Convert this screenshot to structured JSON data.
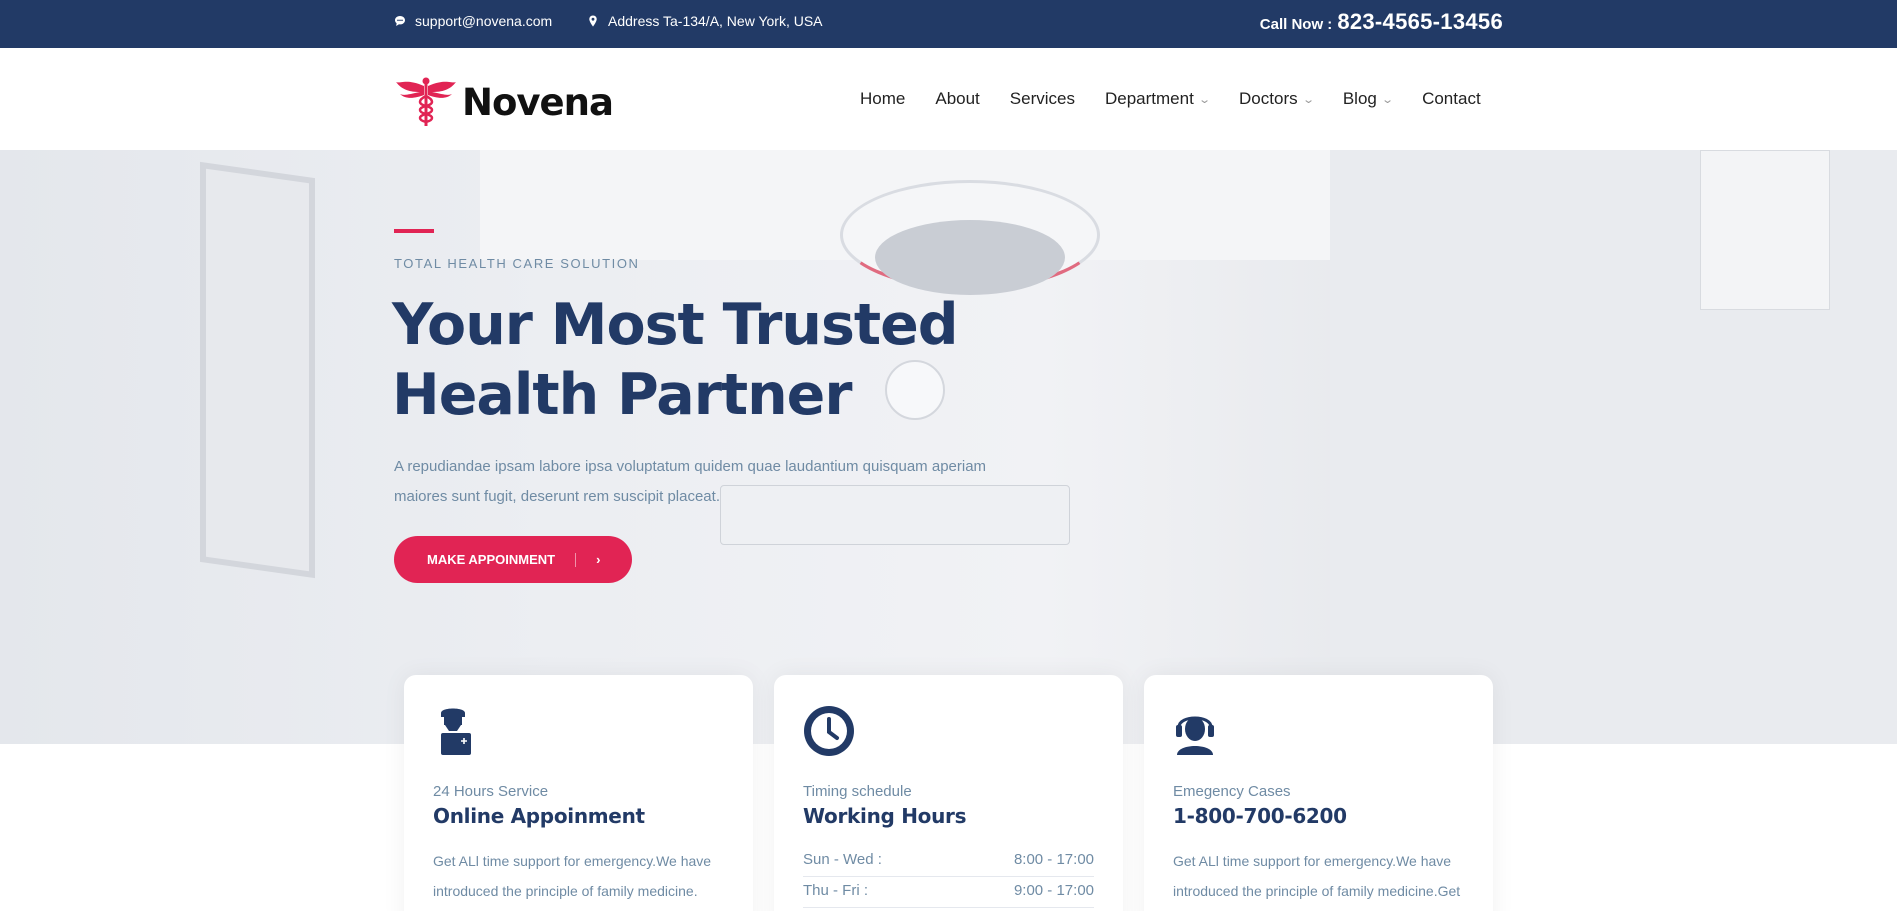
{
  "topbar": {
    "email": "support@novena.com",
    "address": "Address Ta-134/A, New York, USA",
    "call_label": "Call Now :",
    "call_number": "823-4565-13456"
  },
  "nav": {
    "brand": "Novena",
    "items": [
      {
        "label": "Home",
        "dropdown": false
      },
      {
        "label": "About",
        "dropdown": false
      },
      {
        "label": "Services",
        "dropdown": false
      },
      {
        "label": "Department",
        "dropdown": true
      },
      {
        "label": "Doctors",
        "dropdown": true
      },
      {
        "label": "Blog",
        "dropdown": true
      },
      {
        "label": "Contact",
        "dropdown": false
      }
    ]
  },
  "hero": {
    "eyebrow": "Total Health Care Solution",
    "title_line1": "Your Most Trusted",
    "title_line2": "Health Partner",
    "description": "A repudiandae ipsam labore ipsa voluptatum quidem quae laudantium quisquam aperiam maiores sunt fugit, deserunt rem suscipit placeat.",
    "cta_label": "MAKE APPOINMENT"
  },
  "cards": {
    "appointment": {
      "icon": "doctor-icon",
      "subtitle": "24 Hours Service",
      "title": "Online Appoinment",
      "text": "Get ALl time support for emergency.We have introduced the principle of family medicine."
    },
    "hours": {
      "icon": "clock-icon",
      "subtitle": "Timing schedule",
      "title": "Working Hours",
      "rows": [
        {
          "day": "Sun - Wed :",
          "time": "8:00 - 17:00"
        },
        {
          "day": "Thu - Fri :",
          "time": "9:00 - 17:00"
        }
      ]
    },
    "emergency": {
      "icon": "headset-icon",
      "subtitle": "Emegency Cases",
      "title": "1-800-700-6200",
      "text": "Get ALl time support for emergency.We have introduced the principle of family medicine.Get"
    }
  },
  "colors": {
    "primary": "#223a66",
    "accent": "#e12454",
    "muted": "#6f8ba4"
  }
}
